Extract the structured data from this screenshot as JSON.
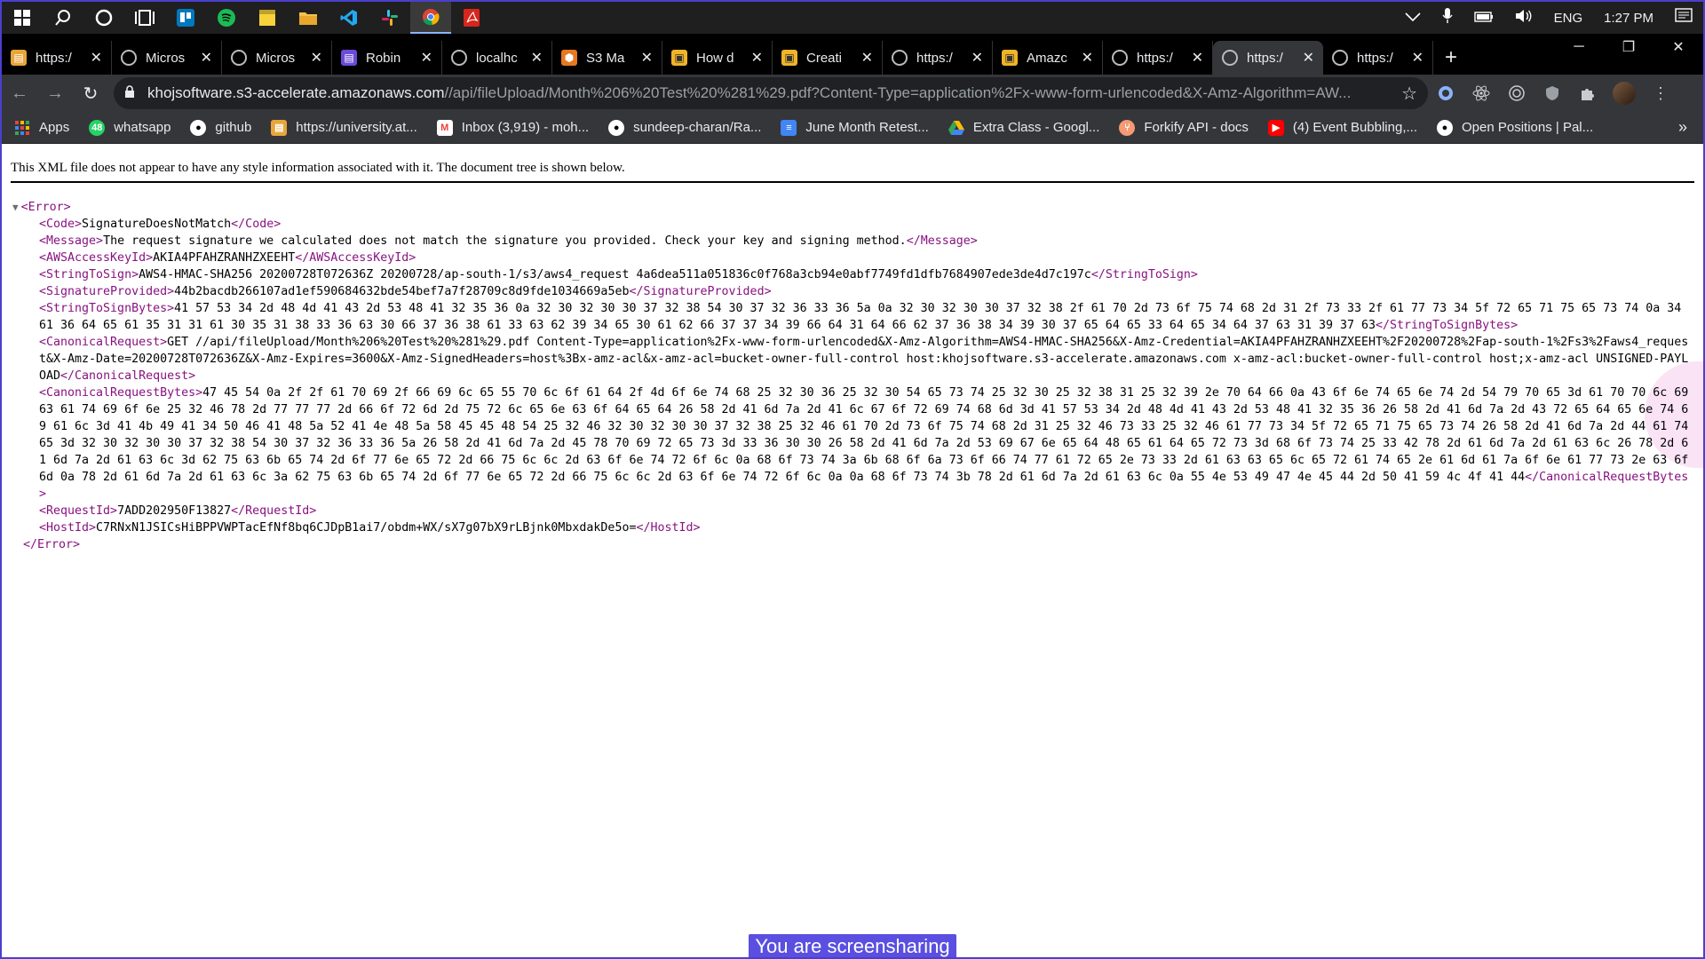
{
  "taskbar": {
    "icons": [
      "windows-icon",
      "search-icon",
      "cortana-icon",
      "task-view-icon",
      "trello-icon",
      "spotify-icon",
      "sticky-notes-icon",
      "file-explorer-icon",
      "vscode-icon",
      "slack-icon",
      "chrome-icon",
      "acrobat-icon"
    ],
    "time": "1:27 PM",
    "lang": "ENG"
  },
  "tabs": [
    {
      "title": "https:/",
      "active": false
    },
    {
      "title": "Micros",
      "active": false
    },
    {
      "title": "Micros",
      "active": false
    },
    {
      "title": "Robin",
      "active": false
    },
    {
      "title": "localhc",
      "active": false
    },
    {
      "title": "S3 Ma",
      "active": false
    },
    {
      "title": "How d",
      "active": false
    },
    {
      "title": "Creati",
      "active": false
    },
    {
      "title": "https:/",
      "active": false
    },
    {
      "title": "Amazc",
      "active": false
    },
    {
      "title": "https:/",
      "active": false
    },
    {
      "title": "https:/",
      "active": true
    },
    {
      "title": "https:/",
      "active": false
    }
  ],
  "address": {
    "host": "khojsoftware.s3-accelerate.amazonaws.com",
    "path": "//api/fileUpload/Month%206%20Test%20%281%29.pdf?Content-Type=application%2Fx-www-form-urlencoded&X-Amz-Algorithm=AW..."
  },
  "bookmarks": [
    {
      "label": "Apps"
    },
    {
      "label": "whatsapp"
    },
    {
      "label": "github"
    },
    {
      "label": "https://university.at..."
    },
    {
      "label": "Inbox (3,919) - moh..."
    },
    {
      "label": "sundeep-charan/Ra..."
    },
    {
      "label": "June Month Retest..."
    },
    {
      "label": "Extra Class - Googl..."
    },
    {
      "label": "Forkify API - docs"
    },
    {
      "label": "(4) Event Bubbling,..."
    },
    {
      "label": "Open Positions | Pal..."
    }
  ],
  "page": {
    "notice": "This XML file does not appear to have any style information associated with it. The document tree is shown below.",
    "xml": {
      "root_open": "<Error>",
      "root_close": "</Error>",
      "elements": [
        {
          "tag": "Code",
          "value": "SignatureDoesNotMatch"
        },
        {
          "tag": "Message",
          "value": "The request signature we calculated does not match the signature you provided. Check your key and signing method."
        },
        {
          "tag": "AWSAccessKeyId",
          "value": "AKIA4PFAHZRANHZXEEHT"
        },
        {
          "tag": "StringToSign",
          "value": "AWS4-HMAC-SHA256 20200728T072636Z 20200728/ap-south-1/s3/aws4_request 4a6dea511a051836c0f768a3cb94e0abf7749fd1dfb7684907ede3de4d7c197c"
        },
        {
          "tag": "SignatureProvided",
          "value": "44b2bacdb266107ad1ef590684632bde54bef7a7f28709c8d9fde1034669a5eb"
        },
        {
          "tag": "StringToSignBytes",
          "value": "41 57 53 34 2d 48 4d 41 43 2d 53 48 41 32 35 36 0a 32 30 32 30 30 37 32 38 54 30 37 32 36 33 36 5a 0a 32 30 32 30 30 37 32 38 2f 61 70 2d 73 6f 75 74 68 2d 31 2f 73 33 2f 61 77 73 34 5f 72 65 71 75 65 73 74 0a 34 61 36 64 65 61 35 31 31 61 30 35 31 38 33 36 63 30 66 37 36 38 61 33 63 62 39 34 65 30 61 62 66 37 37 34 39 66 64 31 64 66 62 37 36 38 34 39 30 37 65 64 65 33 64 65 34 64 37 63 31 39 37 63"
        },
        {
          "tag": "CanonicalRequest",
          "value": "GET //api/fileUpload/Month%206%20Test%20%281%29.pdf Content-Type=application%2Fx-www-form-urlencoded&X-Amz-Algorithm=AWS4-HMAC-SHA256&X-Amz-Credential=AKIA4PFAHZRANHZXEEHT%2F20200728%2Fap-south-1%2Fs3%2Faws4_request&X-Amz-Date=20200728T072636Z&X-Amz-Expires=3600&X-Amz-SignedHeaders=host%3Bx-amz-acl&x-amz-acl=bucket-owner-full-control host:khojsoftware.s3-accelerate.amazonaws.com x-amz-acl:bucket-owner-full-control host;x-amz-acl UNSIGNED-PAYLOAD"
        },
        {
          "tag": "CanonicalRequestBytes",
          "value": "47 45 54 0a 2f 2f 61 70 69 2f 66 69 6c 65 55 70 6c 6f 61 64 2f 4d 6f 6e 74 68 25 32 30 36 25 32 30 54 65 73 74 25 32 30 25 32 38 31 25 32 39 2e 70 64 66 0a 43 6f 6e 74 65 6e 74 2d 54 79 70 65 3d 61 70 70 6c 69 63 61 74 69 6f 6e 25 32 46 78 2d 77 77 77 2d 66 6f 72 6d 2d 75 72 6c 65 6e 63 6f 64 65 64 26 58 2d 41 6d 7a 2d 41 6c 67 6f 72 69 74 68 6d 3d 41 57 53 34 2d 48 4d 41 43 2d 53 48 41 32 35 36 26 58 2d 41 6d 7a 2d 43 72 65 64 65 6e 74 69 61 6c 3d 41 4b 49 41 34 50 46 41 48 5a 52 41 4e 48 5a 58 45 45 48 54 25 32 46 32 30 32 30 30 37 32 38 25 32 46 61 70 2d 73 6f 75 74 68 2d 31 25 32 46 73 33 25 32 46 61 77 73 34 5f 72 65 71 75 65 73 74 26 58 2d 41 6d 7a 2d 44 61 74 65 3d 32 30 32 30 30 37 32 38 54 30 37 32 36 33 36 5a 26 58 2d 41 6d 7a 2d 45 78 70 69 72 65 73 3d 33 36 30 30 26 58 2d 41 6d 7a 2d 53 69 67 6e 65 64 48 65 61 64 65 72 73 3d 68 6f 73 74 25 33 42 78 2d 61 6d 7a 2d 61 63 6c 26 78 2d 61 6d 7a 2d 61 63 6c 3d 62 75 63 6b 65 74 2d 6f 77 6e 65 72 2d 66 75 6c 6c 2d 63 6f 6e 74 72 6f 6c 0a 68 6f 73 74 3a 6b 68 6f 6a 73 6f 66 74 77 61 72 65 2e 73 33 2d 61 63 63 65 6c 65 72 61 74 65 2e 61 6d 61 7a 6f 6e 61 77 73 2e 63 6f 6d 0a 78 2d 61 6d 7a 2d 61 63 6c 3a 62 75 63 6b 65 74 2d 6f 77 6e 65 72 2d 66 75 6c 6c 2d 63 6f 6e 74 72 6f 6c 0a 0a 68 6f 73 74 3b 78 2d 61 6d 7a 2d 61 63 6c 0a 55 4e 53 49 47 4e 45 44 2d 50 41 59 4c 4f 41 44"
        },
        {
          "tag": "RequestId",
          "value": "7ADD202950F13827"
        },
        {
          "tag": "HostId",
          "value": "C7RNxN1JSICsHiBPPVWPTacEfNf8bq6CJDpB1ai7/obdm+WX/sX7g07bX9rLBjnk0MbxdakDe5o="
        }
      ]
    }
  },
  "share_banner": "You are screensharing",
  "colors": {
    "tag": "#881280",
    "accent": "#4a3fcf"
  }
}
